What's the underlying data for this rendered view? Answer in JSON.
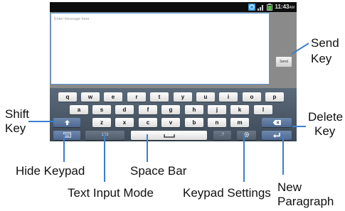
{
  "status_bar": {
    "time": "11:43",
    "ampm": "AM",
    "icons": [
      "sync-icon",
      "signal-icon",
      "battery-icon"
    ]
  },
  "compose": {
    "message_placeholder": "Enter message here",
    "send_label": "Send"
  },
  "keyboard": {
    "row1": [
      "q",
      "w",
      "e",
      "r",
      "t",
      "y",
      "u",
      "i",
      "o",
      "p"
    ],
    "row2": [
      "a",
      "s",
      "d",
      "f",
      "g",
      "h",
      "j",
      "k",
      "l"
    ],
    "row3": [
      "z",
      "x",
      "c",
      "v",
      "b",
      "n",
      "m"
    ],
    "mode_label": "123",
    "punct_label": ".?",
    "shift_icon": "shift-arrow-icon",
    "delete_icon": "backspace-icon",
    "hide_icon": "keyboard-hide-icon",
    "settings_icon": "gear-icon",
    "enter_icon": "return-arrow-icon",
    "space_icon": "space-bar-icon"
  },
  "callouts": {
    "send_key": [
      "Send",
      "Key"
    ],
    "shift_key": [
      "Shift",
      "Key"
    ],
    "delete_key": [
      "Delete",
      "Key"
    ],
    "hide_keypad": "Hide Keypad",
    "space_bar": "Space Bar",
    "text_input_mode": "Text Input Mode",
    "keypad_settings": "Keypad Settings",
    "new_paragraph": [
      "New",
      "Paragraph"
    ]
  },
  "colors": {
    "accent_border": "#5a9be2",
    "keyboard_bg": "#4a5766",
    "function_key": "#5f79a0",
    "callout_line": "#3b7fd0"
  }
}
